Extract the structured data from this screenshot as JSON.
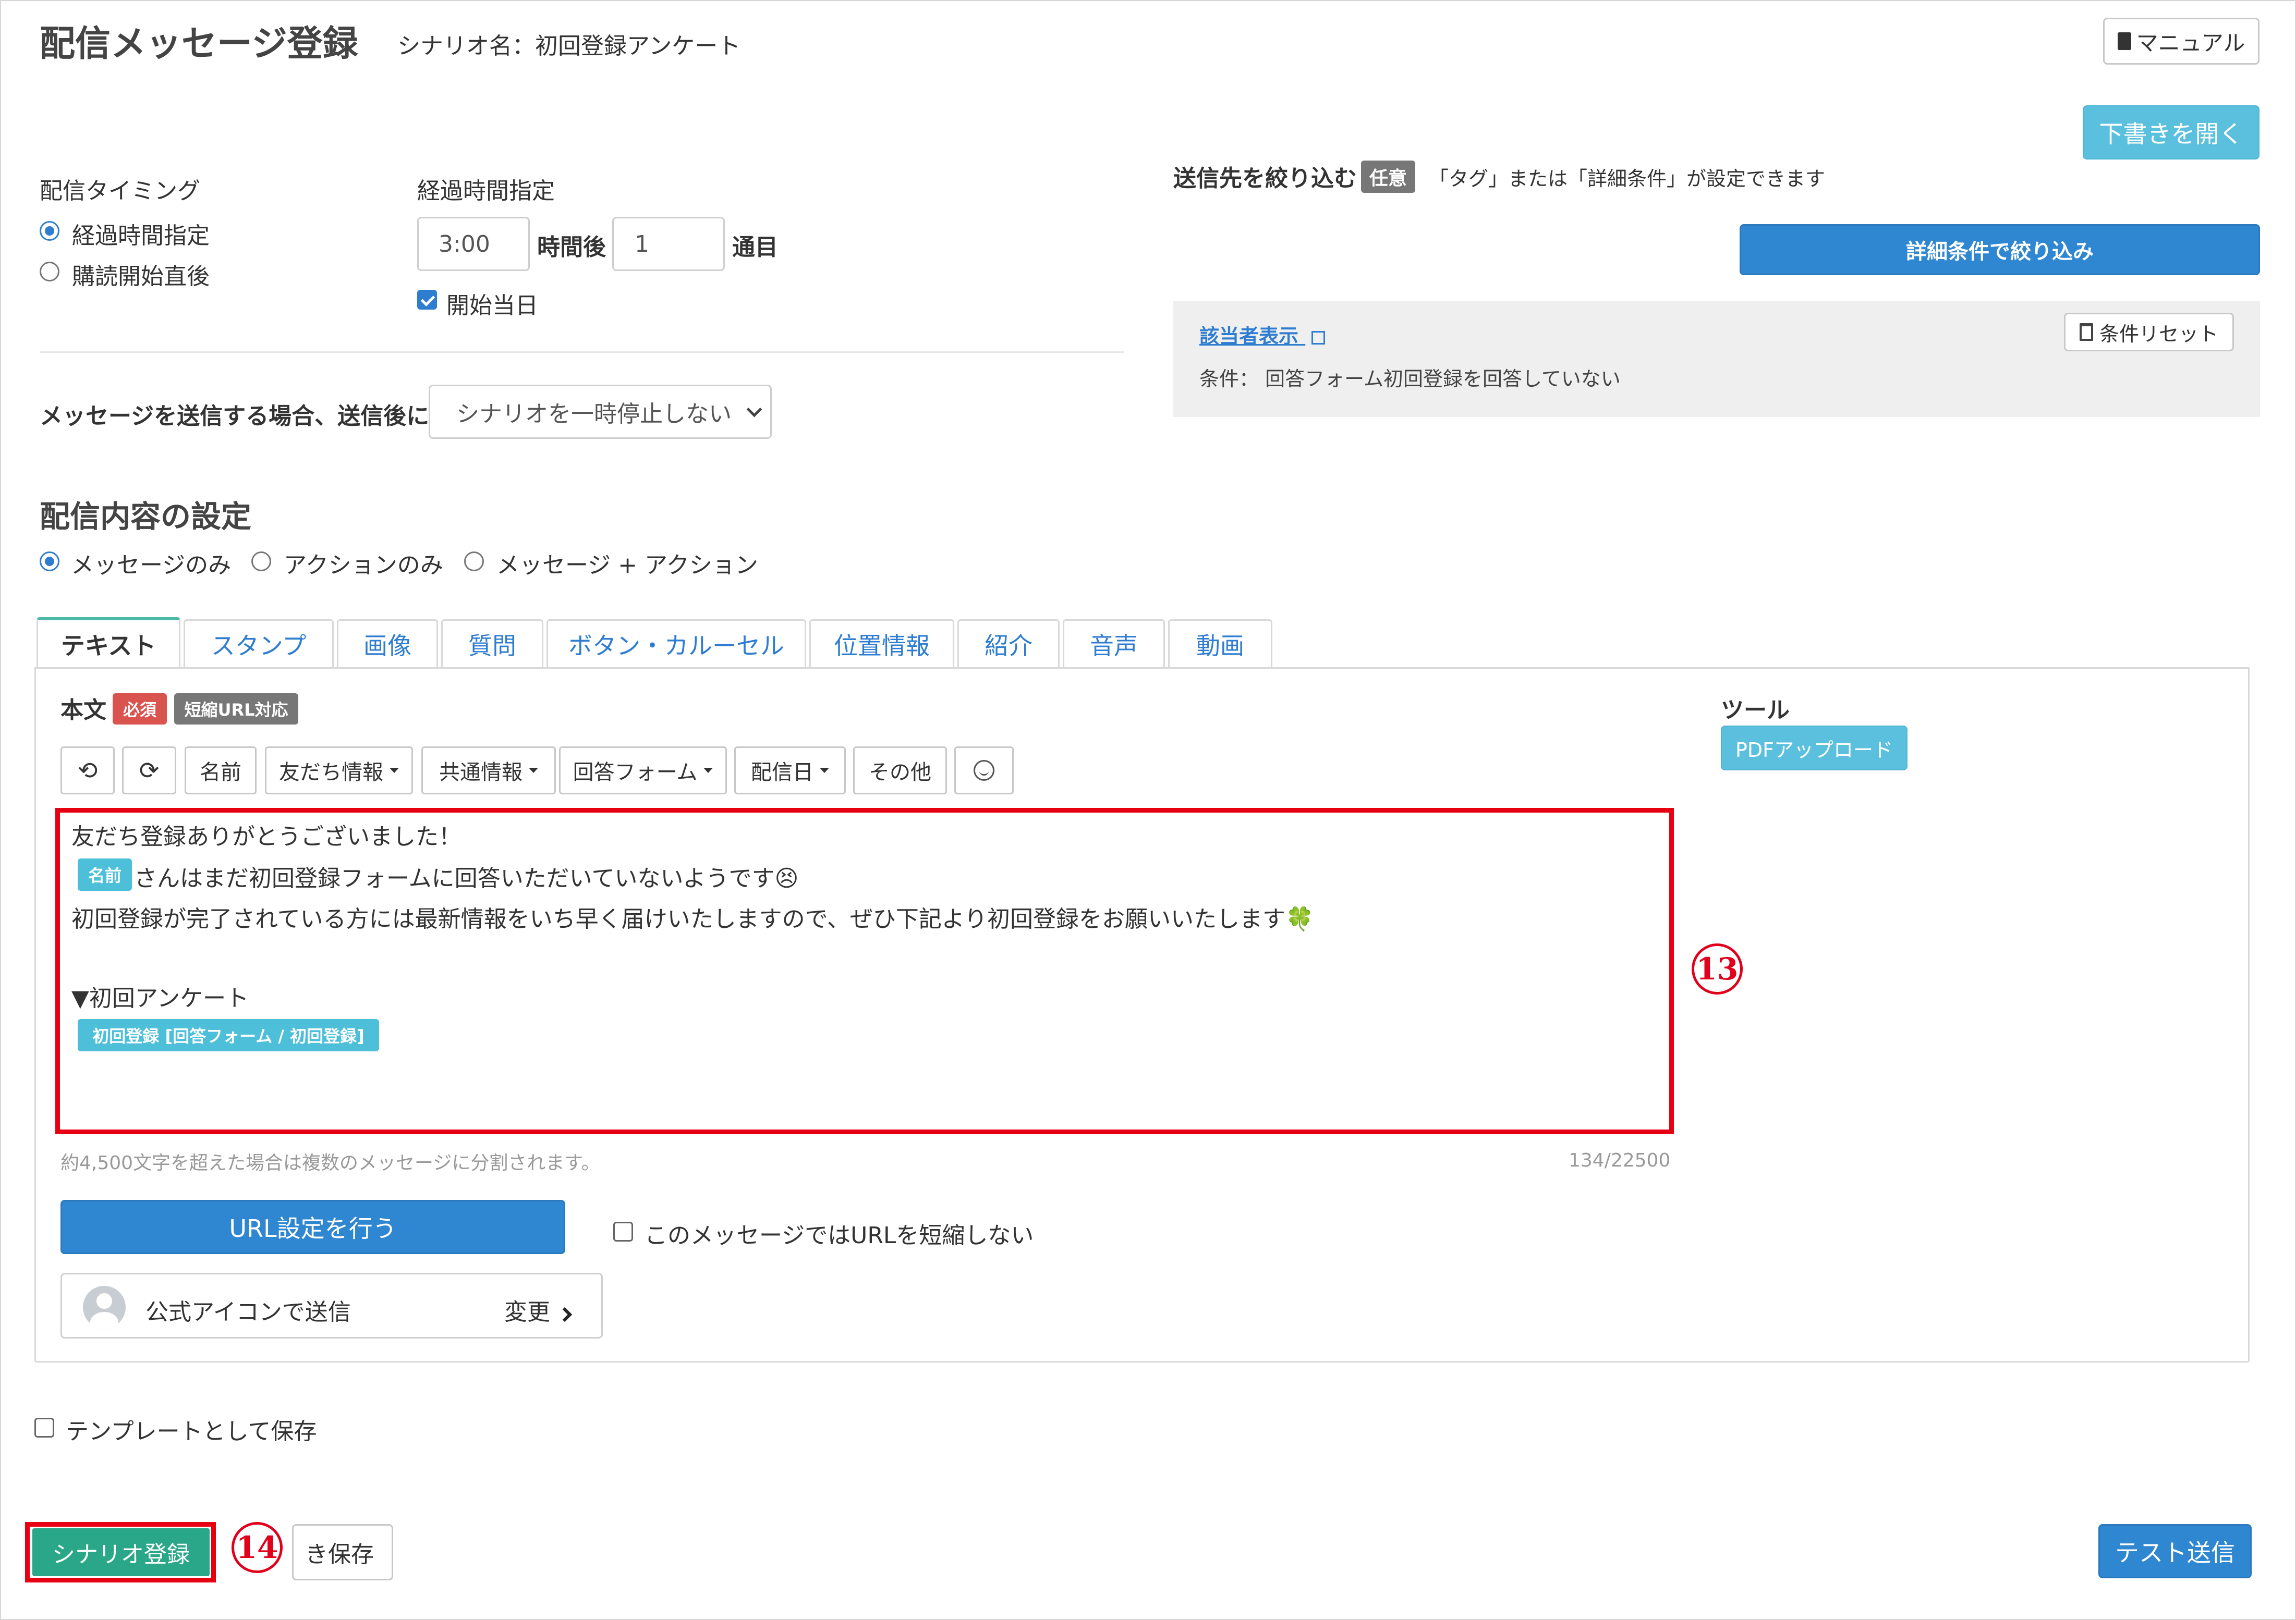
{
  "header": {
    "title": "配信メッセージ登録",
    "scenario_label": "シナリオ名：初回登録アンケート",
    "manual_button": "マニュアル",
    "open_draft_button": "下書きを開く"
  },
  "timing": {
    "label": "配信タイミング",
    "options": [
      "経過時間指定",
      "購読開始直後"
    ],
    "selected": "経過時間指定",
    "elapsed_label": "経過時間指定",
    "time_value": "3:00",
    "hours_after": "時間後",
    "count_value": "1",
    "count_unit": "通目",
    "start_day_label": "開始当日",
    "start_day_checked": true
  },
  "after_send": {
    "label": "メッセージを送信する場合、送信後に",
    "selected_option": "シナリオを一時停止しない"
  },
  "filter": {
    "title": "送信先を絞り込む",
    "optional_badge": "任意",
    "description": "「タグ」または「詳細条件」が設定できます",
    "detail_button": "詳細条件で絞り込み",
    "target_link": "該当者表示",
    "reset_button": "条件リセット",
    "condition_text": "条件：  回答フォーム初回登録を回答していない"
  },
  "content": {
    "title": "配信内容の設定",
    "types": [
      "メッセージのみ",
      "アクションのみ",
      "メッセージ + アクション"
    ],
    "selected_type": "メッセージのみ"
  },
  "tabs": [
    "テキスト",
    "スタンプ",
    "画像",
    "質問",
    "ボタン・カルーセル",
    "位置情報",
    "紹介",
    "音声",
    "動画"
  ],
  "editor": {
    "body_label": "本文",
    "required_badge": "必須",
    "short_url_badge": "短縮URL対応",
    "toolbar": {
      "name": "名前",
      "friend_info": "友だち情報",
      "common_info": "共通情報",
      "answer_form": "回答フォーム",
      "delivery_date": "配信日",
      "other": "その他"
    },
    "lines": {
      "line1": "友だち登録ありがとうございました！",
      "name_tag": "名前",
      "line2": "さんはまだ初回登録フォームに回答いただいていないようです😣",
      "line3": "初回登録が完了されている方には最新情報をいち早く届けいたしますので、ぜひ下記より初回登録をお願いいたします🍀",
      "line4": "▼初回アンケート",
      "form_tag": "初回登録 [回答フォーム / 初回登録]"
    },
    "split_note": "約4,500文字を超えた場合は複数のメッセージに分割されます。",
    "char_count": "134/22500",
    "url_button": "URL設定を行う",
    "no_shorten_label": "このメッセージではURLを短縮しない",
    "sender_label": "公式アイコンで送信",
    "change_label": "変更"
  },
  "tools": {
    "label": "ツール",
    "pdf_button": "PDFアップロード"
  },
  "template_save_label": "テンプレートとして保存",
  "footer": {
    "register_button": "シナリオ登録",
    "draft_save_button": "き保存",
    "test_send_button": "テスト送信"
  },
  "annotations": {
    "step13": "13",
    "step14": "14"
  },
  "colors": {
    "primary_blue": "#2f86d1",
    "light_blue": "#5bc0de",
    "green": "#2aa688",
    "highlight_red": "#e0001b",
    "required_red": "#d9534f",
    "badge_gray": "#777777"
  }
}
